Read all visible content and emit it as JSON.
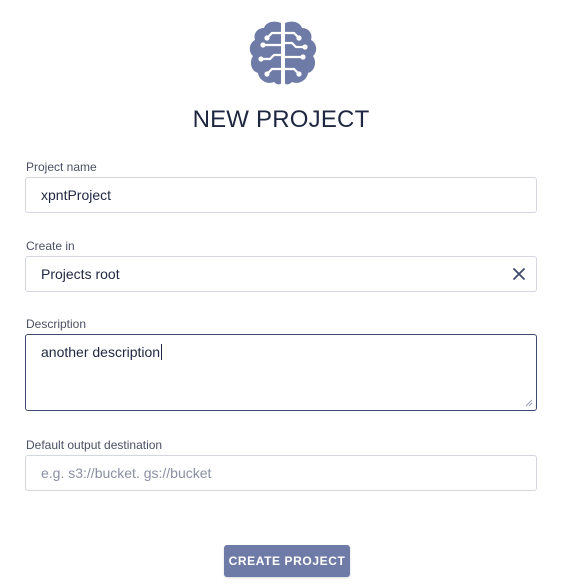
{
  "header": {
    "logo_icon": "brain-circuit-icon",
    "title": "NEW PROJECT"
  },
  "form": {
    "project_name": {
      "label": "Project name",
      "value": "xpntProject"
    },
    "create_in": {
      "label": "Create in",
      "value": "Projects root",
      "clear_icon": "close-icon"
    },
    "description": {
      "label": "Description",
      "value": "another description",
      "focused": true
    },
    "default_output": {
      "label": "Default output destination",
      "value": "",
      "placeholder": "e.g. s3://bucket. gs://bucket"
    }
  },
  "actions": {
    "create_label": "CREATE PROJECT"
  },
  "colors": {
    "brand": "#6e7ba6",
    "text": "#1f2740",
    "border": "#d4d7e0",
    "focus_border": "#3e4a6e"
  }
}
